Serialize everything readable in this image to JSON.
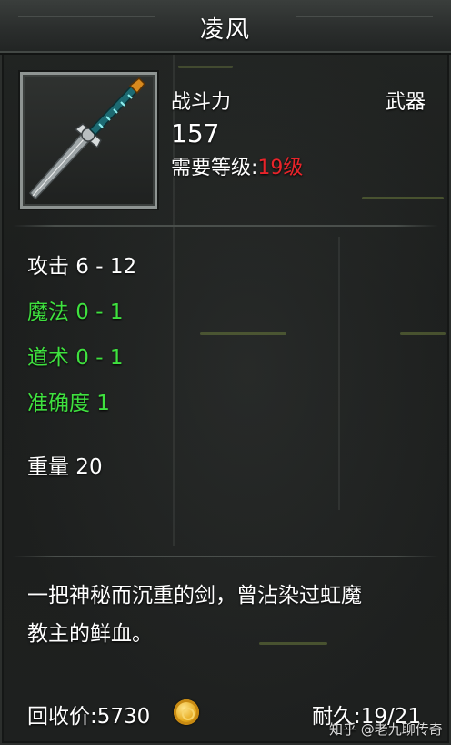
{
  "item": {
    "name": "凌风",
    "combat_power_label": "战斗力",
    "combat_power_value": "157",
    "category": "武器",
    "level_req_label": "需要等级:",
    "level_req_value": "19级",
    "icon": "sword-icon"
  },
  "stats": {
    "attack": "攻击 6 - 12",
    "magic": "魔法 0 - 1",
    "taoism": "道术 0 - 1",
    "accuracy": "准确度 1",
    "weight": "重量 20"
  },
  "description": {
    "line1": "一把神秘而沉重的剑，曾沾染过虹魔",
    "line2": "教主的鲜血。"
  },
  "footer": {
    "recycle_price": "回收价:5730",
    "coin_icon": "gold-coin-icon",
    "durability": "耐久:19/21",
    "watermark": "知乎 @老九聊传奇"
  },
  "colors": {
    "text_white": "#ffffff",
    "stat_green": "#3fe13f",
    "level_red": "#e8242a"
  }
}
